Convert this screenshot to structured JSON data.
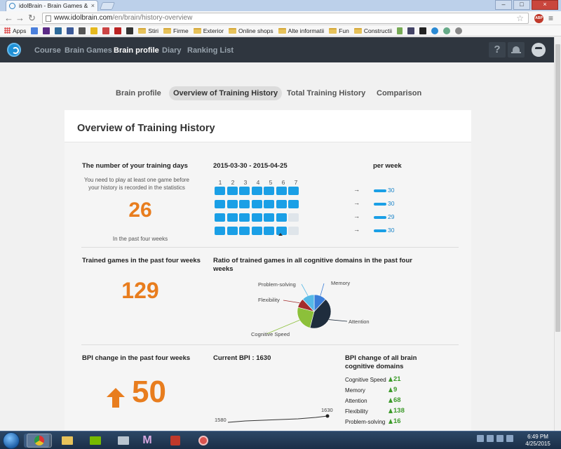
{
  "browser": {
    "tab_title": "idolBrain - Brain Games &",
    "url_host": "www.idolbrain.com",
    "url_path": "/en/brain/history-overview",
    "bookmarks": [
      "Apps",
      "Stiri",
      "Firme",
      "Exterior",
      "Online shops",
      "Alte informatii",
      "Fun",
      "Constructii"
    ]
  },
  "header": {
    "nav": [
      "Course",
      "Brain Games",
      "Brain profile",
      "Diary",
      "Ranking List"
    ],
    "active_nav": "Brain profile",
    "help_label": "?"
  },
  "subtabs": [
    "Brain profile",
    "Overview of Training History",
    "Total Training History",
    "Comparison"
  ],
  "card": {
    "title": "Overview of Training History"
  },
  "training_days": {
    "title": "The number of your training days",
    "note": "You need to play at least one game before your history is recorded in the statistics",
    "value": "26",
    "footnote": "In the past four weeks",
    "date_range": "2015-03-30 - 2015-04-25",
    "day_numbers": [
      "1",
      "2",
      "3",
      "4",
      "5",
      "6",
      "7"
    ],
    "grid": [
      [
        1,
        1,
        1,
        1,
        1,
        1,
        1
      ],
      [
        1,
        1,
        1,
        1,
        1,
        1,
        1
      ],
      [
        1,
        1,
        1,
        1,
        1,
        1,
        0
      ],
      [
        1,
        1,
        1,
        1,
        1,
        1,
        0
      ]
    ],
    "per_week_label": "per week",
    "weekly": [
      "30",
      "30",
      "29",
      "30"
    ],
    "arrow_glyph": "→"
  },
  "trained_games": {
    "title": "Trained games in the past four weeks",
    "value": "129"
  },
  "ratio": {
    "title": "Ratio of trained games in all cognitive domains in the past four weeks",
    "labels": {
      "memory": "Memory",
      "problem_solving": "Problem-solving",
      "flexibility": "Flexibility",
      "cognitive_speed": "Cognitive Speed",
      "attention": "Attention"
    }
  },
  "chart_data": {
    "type": "pie",
    "categories": [
      "Memory",
      "Attention",
      "Cognitive Speed",
      "Flexibility",
      "Problem-solving"
    ],
    "values": [
      12,
      42,
      25,
      9,
      12
    ],
    "colors": [
      "#3a7dd8",
      "#1f2d3d",
      "#8cc03a",
      "#a32b2b",
      "#56b9e6"
    ]
  },
  "bpi": {
    "title": "BPI change in the past four weeks",
    "value": "50",
    "current_label": "Current BPI : 1630",
    "line_start": "1580",
    "line_end": "1630",
    "domains_title": "BPI change of all brain cognitive domains",
    "domains": [
      {
        "name": "Cognitive Speed",
        "value": "21"
      },
      {
        "name": "Memory",
        "value": "9"
      },
      {
        "name": "Attention",
        "value": "68"
      },
      {
        "name": "Flexibility",
        "value": "138"
      },
      {
        "name": "Problem-solving",
        "value": "16"
      }
    ]
  },
  "taskbar": {
    "time": "6:49 PM",
    "date": "4/25/2015",
    "app_m": "M"
  }
}
